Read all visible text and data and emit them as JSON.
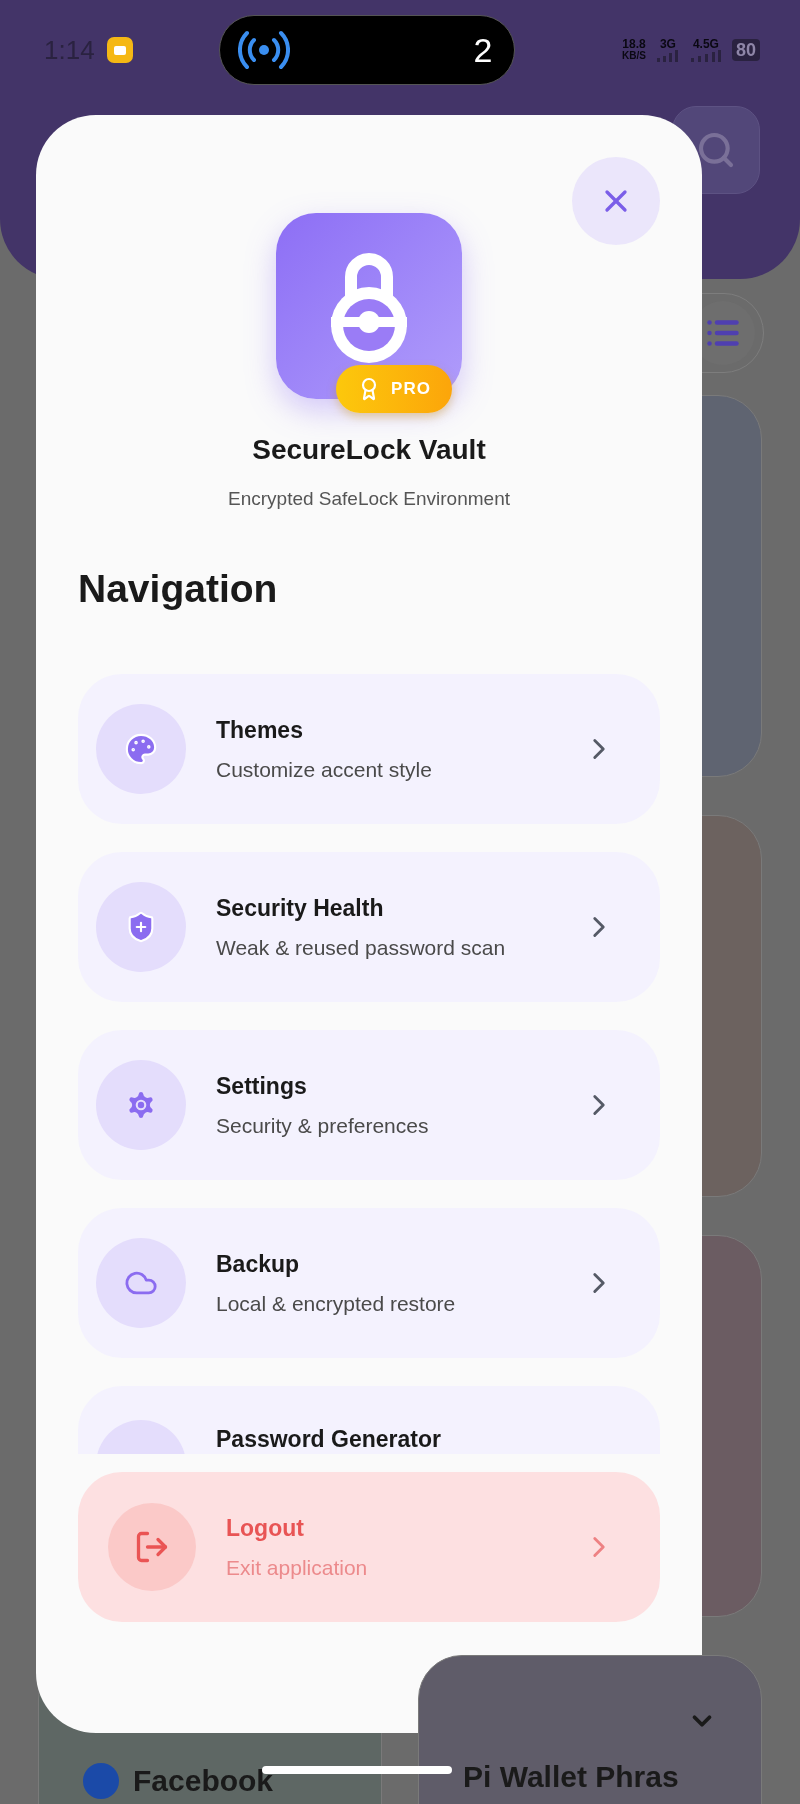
{
  "status_bar": {
    "time": "1:14",
    "island_count": "2",
    "net_speed": "18.8",
    "net_speed_unit": "KB/S",
    "network_1": "3G",
    "network_2": "4.5G",
    "battery": "80"
  },
  "view_toggle": {
    "list_selected": true
  },
  "drawer": {
    "app_name": "SecureLock Vault",
    "tagline": "Encrypted SafeLock Environment",
    "badge": "PRO",
    "section_title": "Navigation",
    "items": [
      {
        "kind": "palette",
        "title": "Themes",
        "subtitle": "Customize accent style"
      },
      {
        "kind": "shield",
        "title": "Security Health",
        "subtitle": "Weak & reused password scan"
      },
      {
        "kind": "gear",
        "title": "Settings",
        "subtitle": "Security & preferences"
      },
      {
        "kind": "cloud",
        "title": "Backup",
        "subtitle": "Local & encrypted restore"
      },
      {
        "kind": "partial",
        "title": "Password Generator"
      }
    ],
    "logout": {
      "title": "Logout",
      "subtitle": "Exit application"
    }
  },
  "background_cards": [
    {
      "kind": "facebook",
      "title": "Facebook"
    },
    {
      "kind": "plain",
      "title": "Pi Wallet Phras"
    }
  ]
}
